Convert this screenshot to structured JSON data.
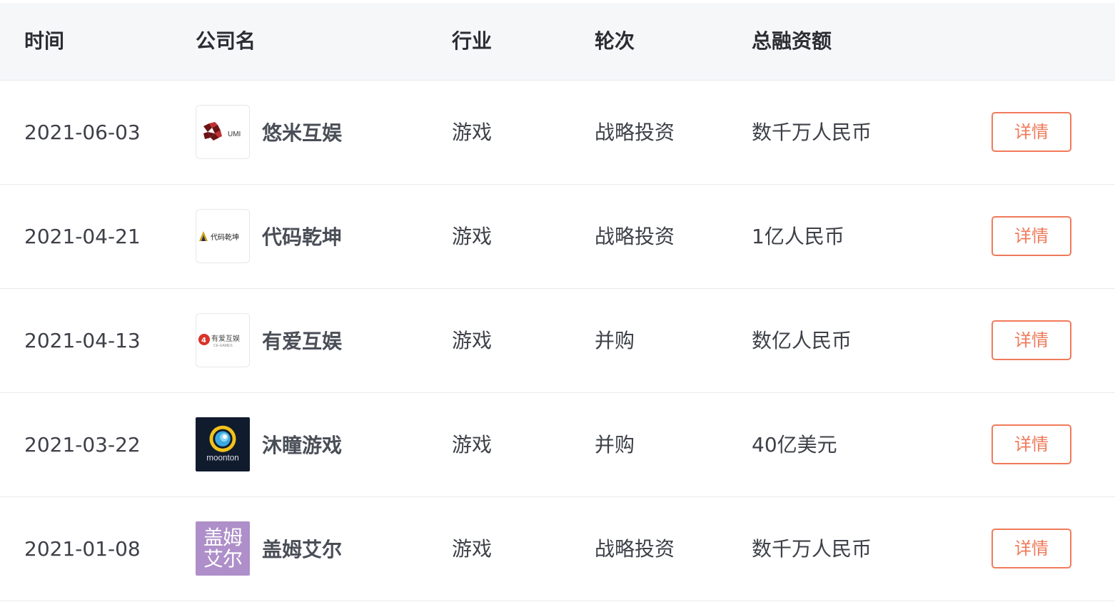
{
  "header": {
    "time": "时间",
    "company": "公司名",
    "industry": "行业",
    "round": "轮次",
    "amount": "总融资额"
  },
  "rows": [
    {
      "date": "2021-06-03",
      "company": "悠米互娱",
      "logo_text": "UMI",
      "logo_icon": "umi-logo-icon",
      "industry": "游戏",
      "round": "战略投资",
      "amount": "数千万人民币",
      "action": "详情"
    },
    {
      "date": "2021-04-21",
      "company": "代码乾坤",
      "logo_text": "代码乾坤",
      "logo_icon": "daima-qiankun-logo-icon",
      "industry": "游戏",
      "round": "战略投资",
      "amount": "1亿人民币",
      "action": "详情"
    },
    {
      "date": "2021-04-13",
      "company": "有爱互娱",
      "logo_text": "有爱互娱",
      "logo_sub": "CE-GAMES",
      "logo_icon": "youai-logo-icon",
      "industry": "游戏",
      "round": "并购",
      "amount": "数亿人民币",
      "action": "详情"
    },
    {
      "date": "2021-03-22",
      "company": "沐瞳游戏",
      "logo_text": "moonton",
      "logo_icon": "moonton-logo-icon",
      "industry": "游戏",
      "round": "并购",
      "amount": "40亿美元",
      "action": "详情"
    },
    {
      "date": "2021-01-08",
      "company": "盖姆艾尔",
      "logo_text_line1": "盖姆",
      "logo_text_line2": "艾尔",
      "logo_icon": "gaimu-aier-logo-icon",
      "industry": "游戏",
      "round": "战略投资",
      "amount": "数千万人民币",
      "action": "详情"
    }
  ],
  "colors": {
    "accent": "#f07a5a",
    "header_bg": "#f6f7f9",
    "border": "#e8eaee"
  }
}
